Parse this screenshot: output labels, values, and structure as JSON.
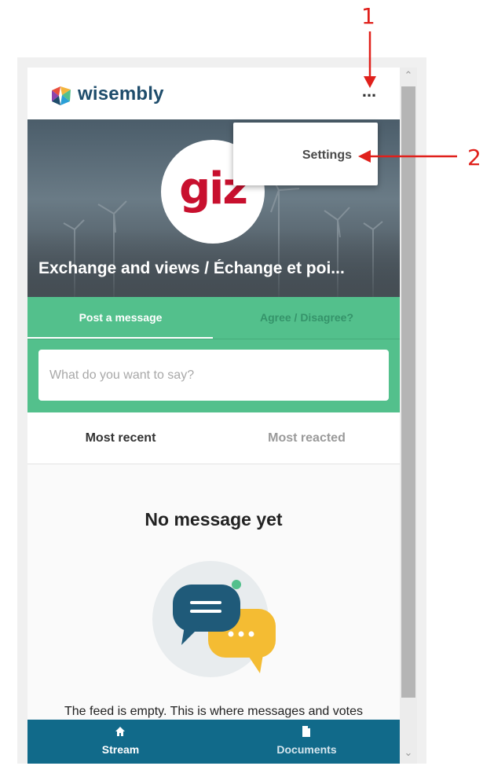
{
  "annotations": {
    "marker_1": "1",
    "marker_2": "2",
    "color": "#e0201b"
  },
  "header": {
    "brand": "wisembly",
    "menu_label": "...",
    "menu_icon": "more-dots-icon"
  },
  "banner": {
    "logo_text": "giz",
    "title": "Exchange and views / Échange et poi..."
  },
  "dropdown": {
    "items": [
      {
        "label": "Settings"
      }
    ]
  },
  "compose": {
    "tabs": [
      {
        "label": "Post a message",
        "active": true
      },
      {
        "label": "Agree / Disagree?",
        "active": false
      }
    ],
    "input_placeholder": "What do you want to say?",
    "accent_color": "#53c08c"
  },
  "sort": {
    "tabs": [
      {
        "label": "Most recent",
        "active": true
      },
      {
        "label": "Most reacted",
        "active": false
      }
    ]
  },
  "feed": {
    "empty_title": "No message yet",
    "empty_text": "The feed is empty. This is where messages and votes"
  },
  "bottom_nav": {
    "items": [
      {
        "label": "Stream",
        "icon": "home-icon",
        "active": true
      },
      {
        "label": "Documents",
        "icon": "document-icon",
        "active": false
      }
    ],
    "color": "#116a8a"
  }
}
